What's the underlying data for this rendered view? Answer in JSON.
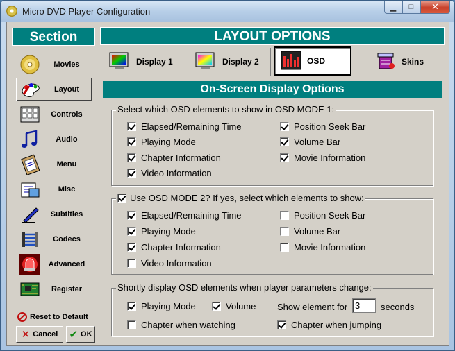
{
  "window": {
    "title": "Micro DVD Player Configuration"
  },
  "sidebar": {
    "heading": "Section",
    "items": [
      {
        "label": "Movies",
        "icon": "disc-icon"
      },
      {
        "label": "Layout",
        "icon": "palette-icon",
        "active": true
      },
      {
        "label": "Controls",
        "icon": "keyboard-icon"
      },
      {
        "label": "Audio",
        "icon": "music-notes-icon"
      },
      {
        "label": "Menu",
        "icon": "clipboard-icon"
      },
      {
        "label": "Misc",
        "icon": "notepad-icon"
      },
      {
        "label": "Subtitles",
        "icon": "pen-icon"
      },
      {
        "label": "Codecs",
        "icon": "spring-icon"
      },
      {
        "label": "Advanced",
        "icon": "siren-icon"
      },
      {
        "label": "Register",
        "icon": "circuit-board-icon"
      }
    ],
    "reset_label": "Reset to Default",
    "cancel_label": "Cancel",
    "ok_label": "OK"
  },
  "main": {
    "heading": "LAYOUT OPTIONS",
    "tabs": [
      {
        "label": "Display 1",
        "icon": "monitor-icon"
      },
      {
        "label": "Display 2",
        "icon": "monitor-icon"
      },
      {
        "label": "OSD",
        "icon": "equalizer-icon",
        "active": true
      },
      {
        "label": "Skins",
        "icon": "paint-jar-icon"
      }
    ],
    "subheading": "On-Screen Display Options"
  },
  "osd1": {
    "legend": "Select which OSD elements to show in OSD MODE 1:",
    "items": [
      {
        "label": "Elapsed/Remaining Time",
        "checked": true
      },
      {
        "label": "Playing Mode",
        "checked": true
      },
      {
        "label": "Chapter Information",
        "checked": true
      },
      {
        "label": "Video Information",
        "checked": true
      },
      {
        "label": "Position Seek Bar",
        "checked": true
      },
      {
        "label": "Volume Bar",
        "checked": true
      },
      {
        "label": "Movie Information",
        "checked": true
      }
    ]
  },
  "osd2": {
    "legend": "Use OSD MODE 2? If yes, select which elements to show:",
    "enabled": true,
    "items": [
      {
        "label": "Elapsed/Remaining Time",
        "checked": true
      },
      {
        "label": "Playing Mode",
        "checked": true
      },
      {
        "label": "Chapter Information",
        "checked": true
      },
      {
        "label": "Video Information",
        "checked": false
      },
      {
        "label": "Position Seek Bar",
        "checked": false
      },
      {
        "label": "Volume Bar",
        "checked": false
      },
      {
        "label": "Movie Information",
        "checked": false
      }
    ]
  },
  "shortly": {
    "legend": "Shortly display OSD elements when player parameters change:",
    "playing_mode": {
      "label": "Playing Mode",
      "checked": true
    },
    "volume": {
      "label": "Volume",
      "checked": true
    },
    "show_for_label": "Show element for",
    "seconds_value": "3",
    "seconds_label": "seconds",
    "chapter_watching": {
      "label": "Chapter when watching",
      "checked": false
    },
    "chapter_jumping": {
      "label": "Chapter when jumping",
      "checked": true
    }
  },
  "colors": {
    "header_teal": "#007f7f",
    "face": "#d4d0c8"
  }
}
